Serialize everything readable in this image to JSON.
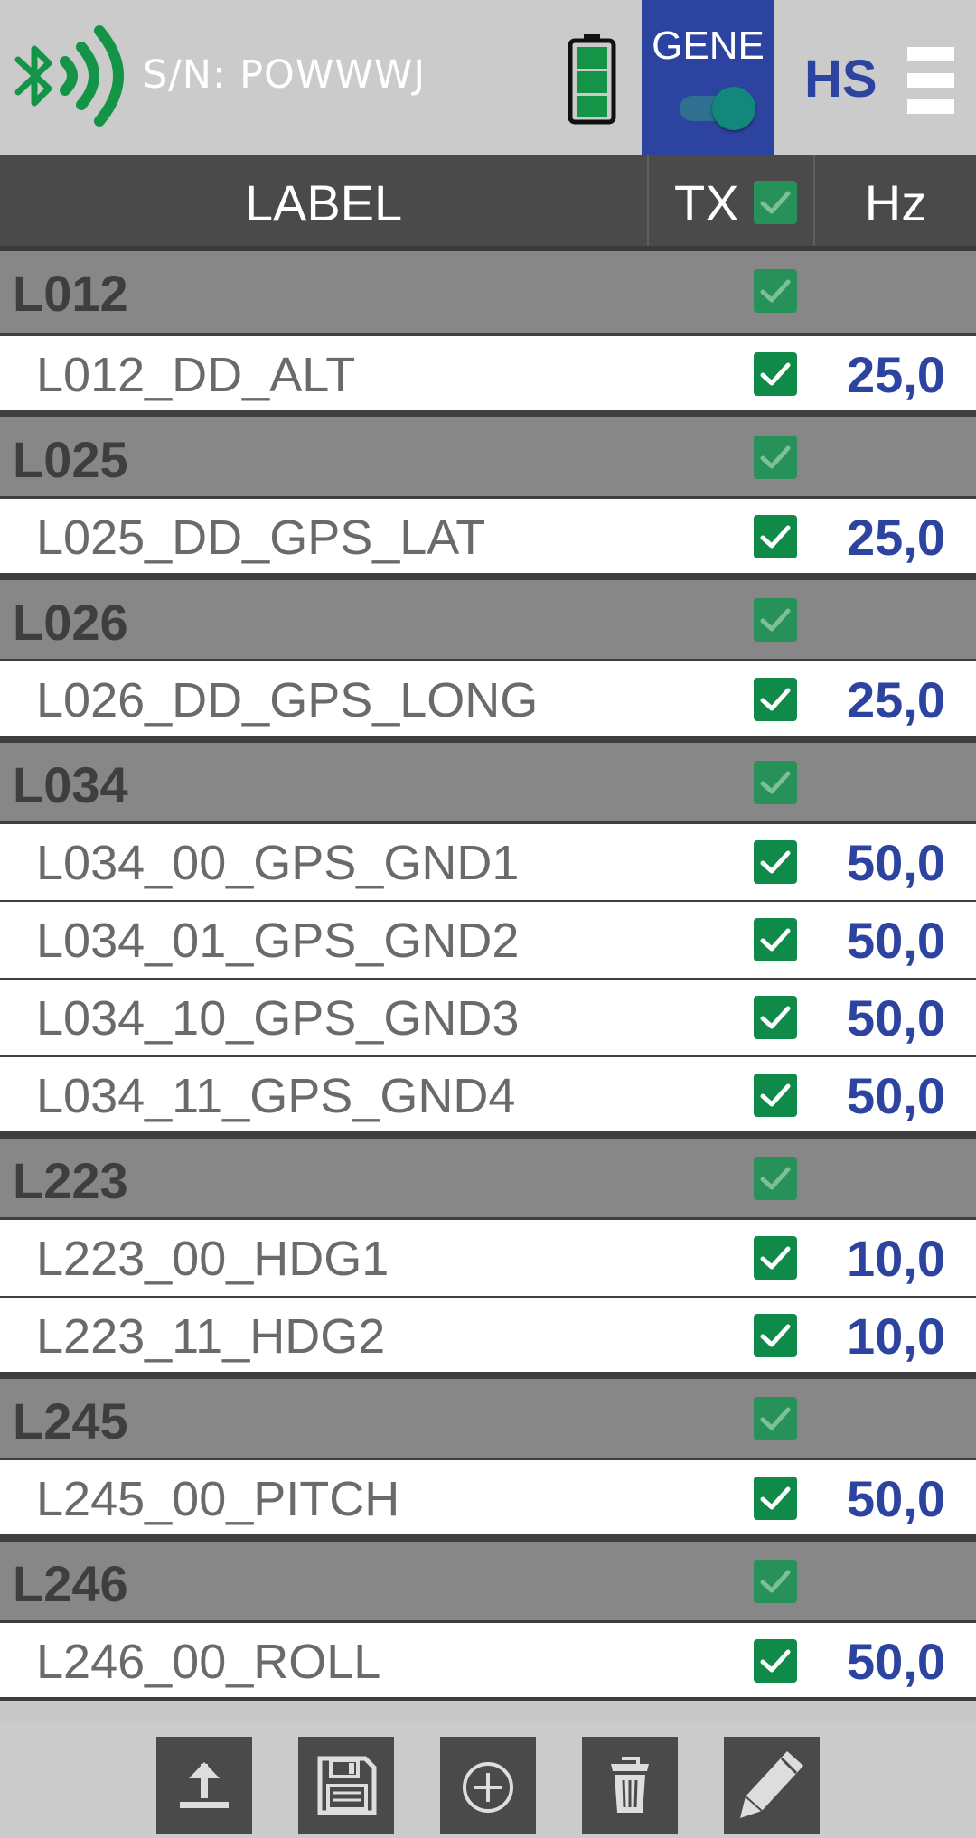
{
  "topbar": {
    "serial": "S/N: POWWWJ",
    "mode_label": "GENE",
    "mode_toggle_on": true,
    "speed_label": "HS",
    "icons": [
      "bluetooth-icon",
      "signal-waves-icon",
      "battery-icon",
      "menu-icon"
    ]
  },
  "table": {
    "headers": {
      "label": "LABEL",
      "tx": "TX",
      "hz": "Hz"
    },
    "header_tx_checked": true
  },
  "groups": [
    {
      "name": "L012",
      "checked": true,
      "items": [
        {
          "name": "L012_DD_ALT",
          "checked": true,
          "hz": "25,0"
        }
      ]
    },
    {
      "name": "L025",
      "checked": true,
      "items": [
        {
          "name": "L025_DD_GPS_LAT",
          "checked": true,
          "hz": "25,0"
        }
      ]
    },
    {
      "name": "L026",
      "checked": true,
      "items": [
        {
          "name": "L026_DD_GPS_LONG",
          "checked": true,
          "hz": "25,0"
        }
      ]
    },
    {
      "name": "L034",
      "checked": true,
      "items": [
        {
          "name": "L034_00_GPS_GND1",
          "checked": true,
          "hz": "50,0"
        },
        {
          "name": "L034_01_GPS_GND2",
          "checked": true,
          "hz": "50,0"
        },
        {
          "name": "L034_10_GPS_GND3",
          "checked": true,
          "hz": "50,0"
        },
        {
          "name": "L034_11_GPS_GND4",
          "checked": true,
          "hz": "50,0"
        }
      ]
    },
    {
      "name": "L223",
      "checked": true,
      "items": [
        {
          "name": "L223_00_HDG1",
          "checked": true,
          "hz": "10,0"
        },
        {
          "name": "L223_11_HDG2",
          "checked": true,
          "hz": "10,0"
        }
      ]
    },
    {
      "name": "L245",
      "checked": true,
      "items": [
        {
          "name": "L245_00_PITCH",
          "checked": true,
          "hz": "50,0"
        }
      ]
    },
    {
      "name": "L246",
      "checked": true,
      "items": [
        {
          "name": "L246_00_ROLL",
          "checked": true,
          "hz": "50,0"
        }
      ]
    }
  ],
  "toolbar": {
    "buttons": [
      {
        "name": "upload-button",
        "icon": "upload-icon"
      },
      {
        "name": "save-button",
        "icon": "floppy-disk-icon"
      },
      {
        "name": "add-button",
        "icon": "plus-circle-icon"
      },
      {
        "name": "delete-button",
        "icon": "trash-icon"
      },
      {
        "name": "edit-button",
        "icon": "pencil-icon"
      }
    ]
  },
  "colors": {
    "accent_blue": "#2d43a0",
    "check_green": "#0f8a48",
    "bluetooth_green": "#139447",
    "header_bg": "#4a4a4a",
    "group_bg": "#878787"
  }
}
